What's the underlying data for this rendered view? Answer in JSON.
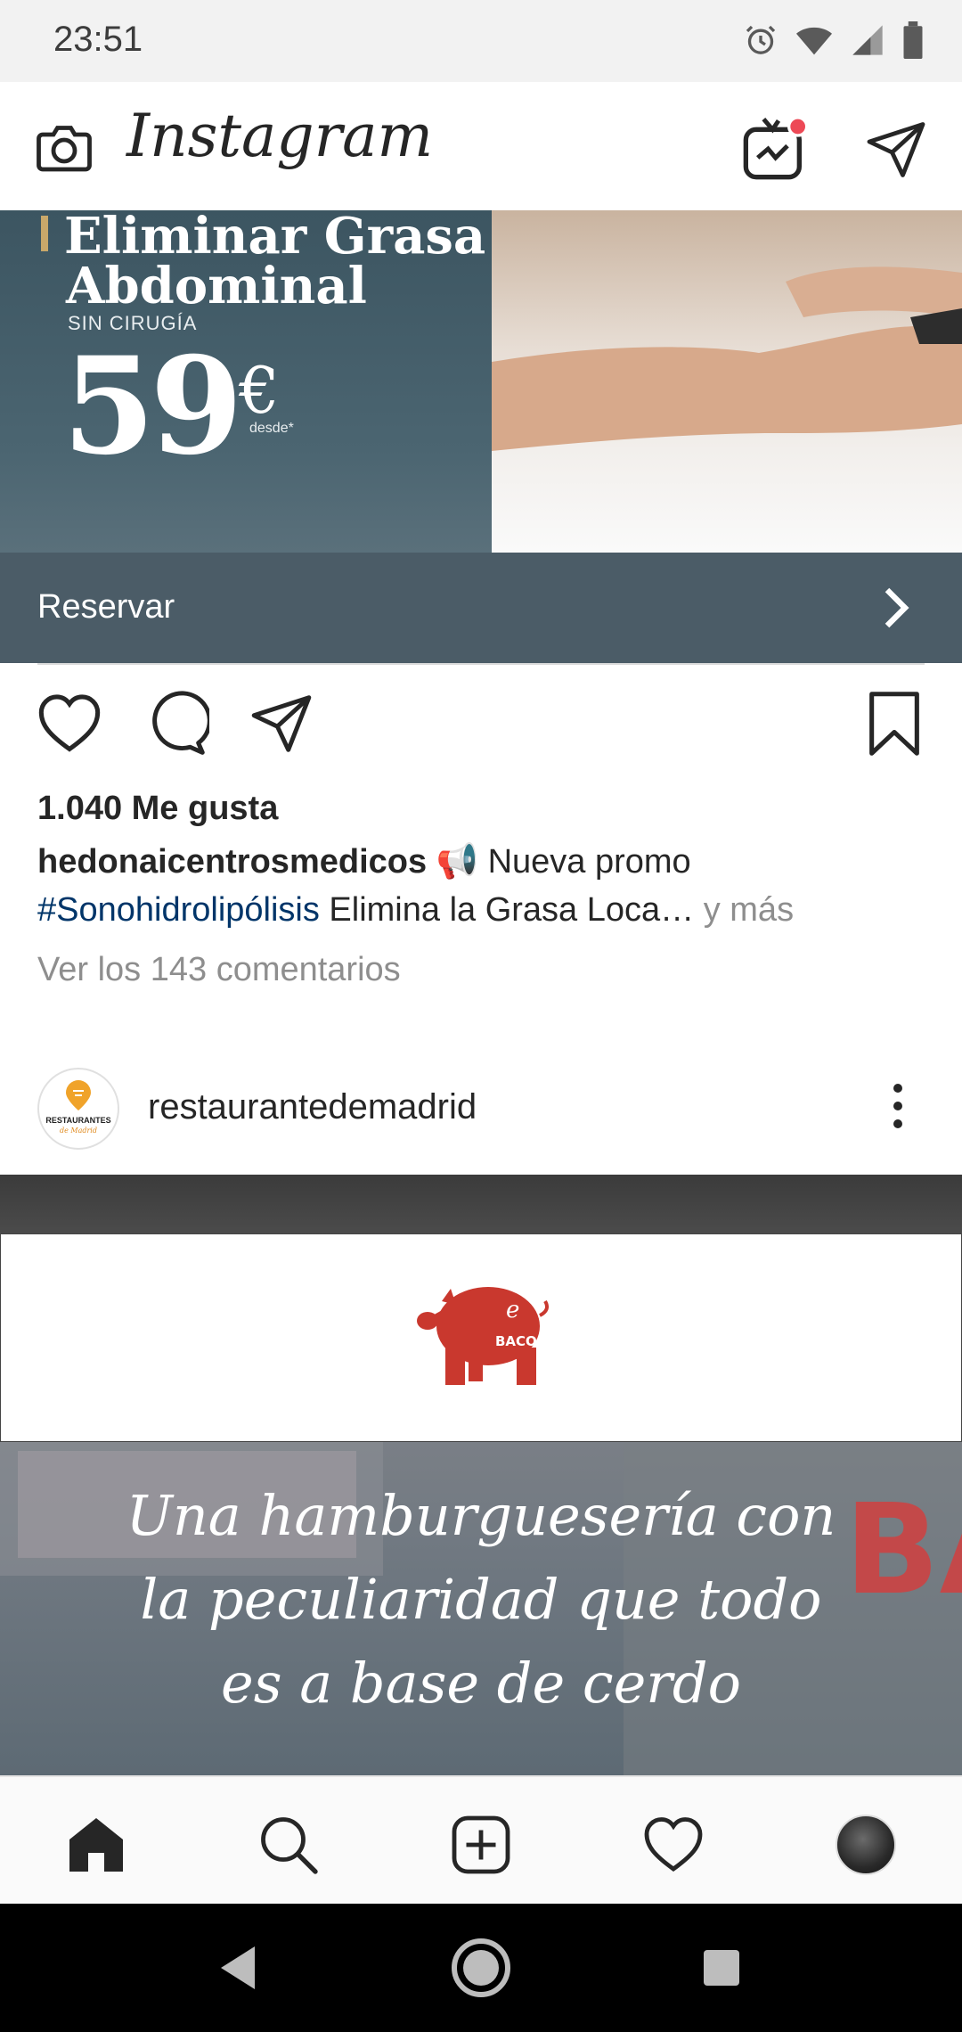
{
  "status_bar": {
    "time": "23:51"
  },
  "app": {
    "title": "Instagram"
  },
  "ad_post": {
    "headline_line1": "Eliminar Grasa",
    "headline_line2": "Abdominal",
    "subheadline": "SIN CIRUGÍA",
    "price": "59",
    "currency": "€",
    "price_note": "desde*",
    "cta_label": "Reservar",
    "likes": "1.040 Me gusta",
    "username": "hedonaicentrosmedicos",
    "caption_emoji": "📢",
    "caption_text": "Nueva promo",
    "hashtag": "#Sonohidrolipólisis",
    "caption_rest": "Elimina la Grasa Loca…",
    "more_label": "y más",
    "comments_label": "Ver los 143 comentarios"
  },
  "next_post": {
    "username": "restaurantedemadrid",
    "avatar_text_top": "RESTAURANTES",
    "avatar_text_bottom": "de Madrid",
    "logo_text": "BACON",
    "image_text_line1": "Una hamburguesería con",
    "image_text_line2": "la peculiaridad que todo",
    "image_text_line3": "es a base de cerdo",
    "sign_text": "BAC"
  },
  "colors": {
    "cta_bg": "#4b5c67",
    "hashtag": "#003569",
    "notification_dot": "#ed4956",
    "pig_red": "#c9382e"
  }
}
